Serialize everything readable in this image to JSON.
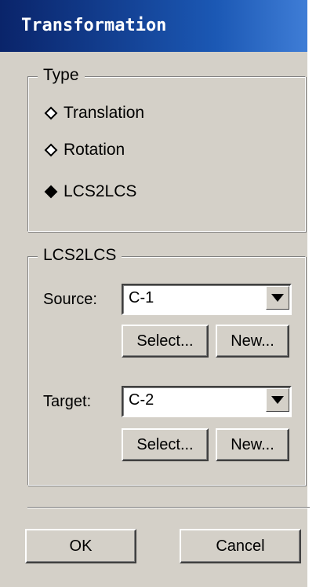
{
  "window": {
    "title": "Transformation"
  },
  "type_group": {
    "legend": "Type",
    "options": [
      {
        "label": "Translation",
        "selected": false
      },
      {
        "label": "Rotation",
        "selected": false
      },
      {
        "label": "LCS2LCS",
        "selected": true
      }
    ]
  },
  "lcs_group": {
    "legend": "LCS2LCS",
    "source": {
      "label": "Source:",
      "value": "C-1",
      "select_label": "Select...",
      "new_label": "New..."
    },
    "target": {
      "label": "Target:",
      "value": "C-2",
      "select_label": "Select...",
      "new_label": "New..."
    }
  },
  "footer": {
    "ok_label": "OK",
    "cancel_label": "Cancel"
  },
  "colors": {
    "dialog_face": "#d4d0c8",
    "title_bar": "#0a246a",
    "title_text": "#ffffff"
  }
}
